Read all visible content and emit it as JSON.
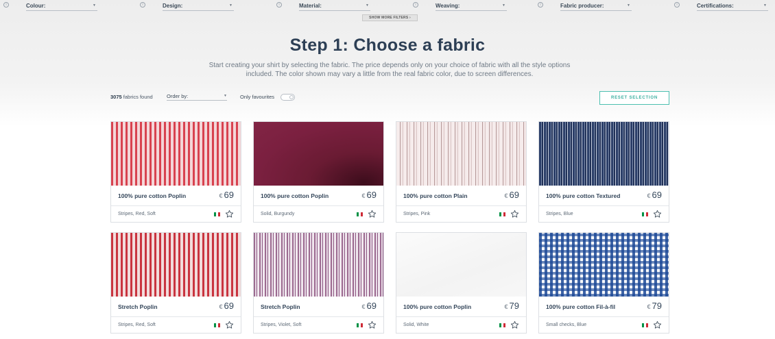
{
  "filters": [
    {
      "label": "Colour:"
    },
    {
      "label": "Design:"
    },
    {
      "label": "Material:"
    },
    {
      "label": "Weaving:"
    },
    {
      "label": "Fabric producer:"
    },
    {
      "label": "Certifications:"
    }
  ],
  "show_more_filters": "SHOW MORE FILTERS ›",
  "title": "Step 1: Choose a fabric",
  "intro": "Start creating your shirt by selecting the fabric. The price depends only on your choice of fabric with all the style options included. The color shown may vary a little from the real fabric color, due to screen differences.",
  "toolbar": {
    "count": "3075",
    "count_suffix": "fabrics found",
    "order_label": "Order by:",
    "favourites_label": "Only favourites",
    "reset_label": "RESET SELECTION"
  },
  "currency": "€",
  "flag_colors": [
    "#009246",
    "#ffffff",
    "#ce2b37"
  ],
  "fabrics": [
    {
      "name": "100% pure cotton Poplin",
      "price": "69",
      "tags": "Stripes, Red, Soft",
      "swatch": "red-stripes"
    },
    {
      "name": "100% pure cotton Poplin",
      "price": "69",
      "tags": "Solid, Burgundy",
      "swatch": "burgundy"
    },
    {
      "name": "100% pure cotton Plain",
      "price": "69",
      "tags": "Stripes, Pink",
      "swatch": "pink-plain"
    },
    {
      "name": "100% pure cotton Textured",
      "price": "69",
      "tags": "Stripes, Blue",
      "swatch": "blue-textured"
    },
    {
      "name": "Stretch Poplin",
      "price": "69",
      "tags": "Stripes, Red, Soft",
      "swatch": "red-stretch"
    },
    {
      "name": "Stretch Poplin",
      "price": "69",
      "tags": "Stripes, Violet, Soft",
      "swatch": "violet"
    },
    {
      "name": "100% pure cotton Poplin",
      "price": "79",
      "tags": "Solid, White",
      "swatch": "white"
    },
    {
      "name": "100% pure cotton Fil-à-fil",
      "price": "79",
      "tags": "Small checks, Blue",
      "swatch": "checks"
    }
  ]
}
